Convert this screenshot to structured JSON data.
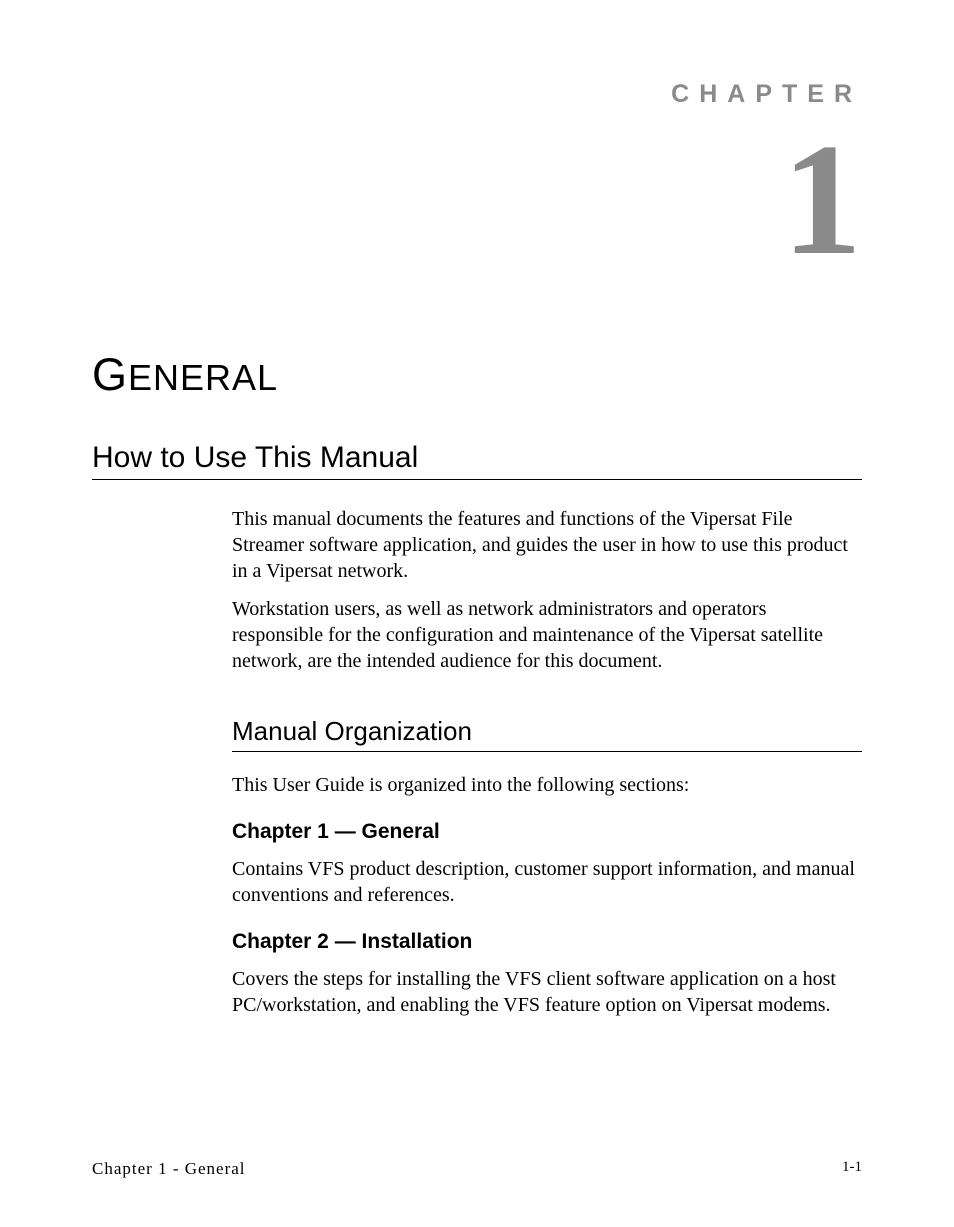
{
  "header": {
    "chapter_label": "CHAPTER",
    "chapter_number": "1"
  },
  "title": "GENERAL",
  "sections": {
    "h1": "How to Use This Manual",
    "intro_p1": "This manual documents the features and functions of the Vipersat File Streamer software application, and guides the user in how to use this product in a Vipersat network.",
    "intro_p2": "Workstation users, as well as network administrators and operators responsible for the configuration and maintenance of the Vipersat satellite network, are the intended audience for this document.",
    "h2": "Manual Organization",
    "org_intro": "This User Guide is organized into the following sections:",
    "chapter1_heading": "Chapter 1 — General",
    "chapter1_text": "Contains VFS product description, customer support information, and manual conventions and references.",
    "chapter2_heading": "Chapter 2 — Installation",
    "chapter2_text": "Covers the steps for installing the VFS client software application on a host PC/workstation, and enabling the VFS feature option on Vipersat modems."
  },
  "footer": {
    "left": "Chapter 1 - General",
    "right": "1-1"
  }
}
